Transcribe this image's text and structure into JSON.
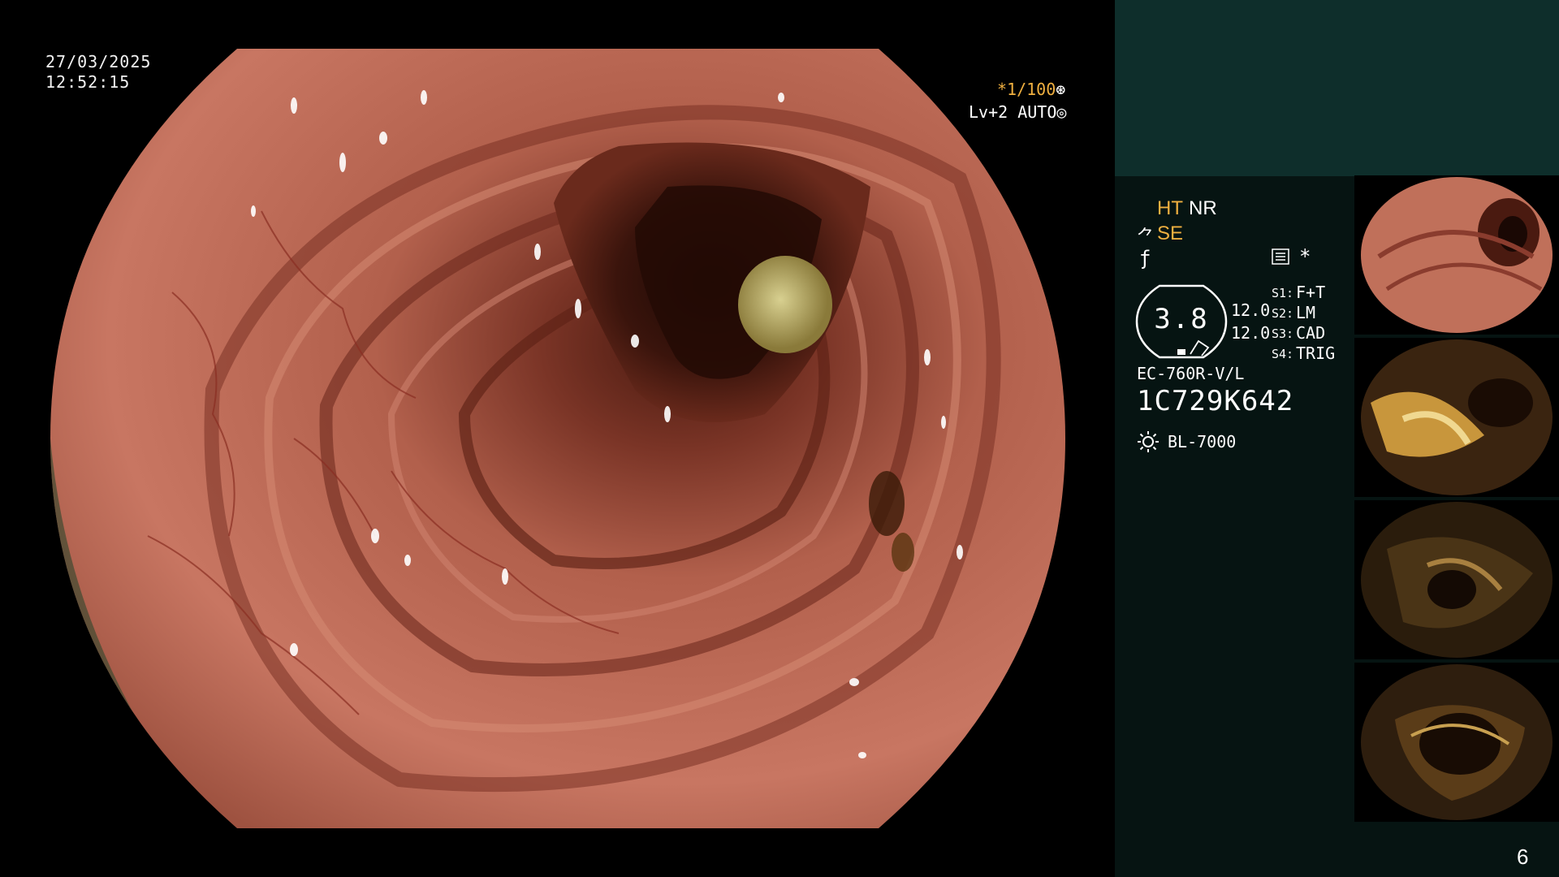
{
  "overlay": {
    "date": "27/03/2025",
    "time": "12:52:15",
    "shutter": "*1/100",
    "shutter_icon": "⊛",
    "level": "Lv+2 AUTO",
    "level_icon": "◎"
  },
  "panel": {
    "ht_label": "HT",
    "nr_label": "NR",
    "se_label": "SE",
    "se_icon": "⺈",
    "f_icon": "ƒ",
    "star_icon": "*",
    "gauge_value": "3.8",
    "readings": [
      "12.0",
      "12.0"
    ],
    "switches": [
      {
        "key": "S1:",
        "value": "F+T"
      },
      {
        "key": "S2:",
        "value": "LM"
      },
      {
        "key": "S3:",
        "value": "CAD"
      },
      {
        "key": "S4:",
        "value": "TRIG"
      }
    ],
    "scope_model": "EC-760R-V/L",
    "serial": "1C729K642",
    "light_source": "BL-7000",
    "page_number": "6"
  },
  "colors": {
    "mucosa": "#c4705a",
    "mucosa_dark": "#8a3c2e",
    "lumen": "#2a0e08",
    "panel_top": "#0e2e2b",
    "panel_body": "#061412",
    "accent": "#f0b040"
  },
  "icons": [
    "shutter-icon",
    "auto-icon",
    "structure-enhance-icon",
    "freeze-icon",
    "menu-icon",
    "star-icon",
    "light-source-icon"
  ]
}
